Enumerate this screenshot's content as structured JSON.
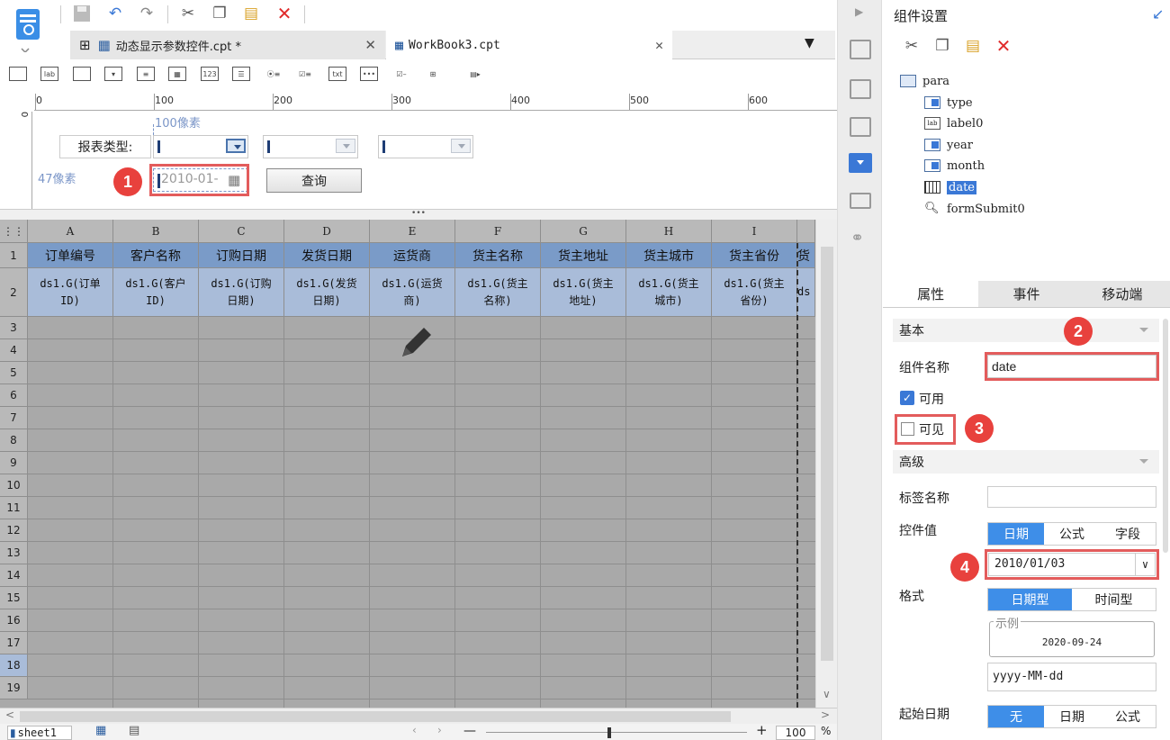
{
  "tabs": [
    {
      "label": "动态显示参数控件.cpt *"
    },
    {
      "label": "WorkBook3.cpt"
    }
  ],
  "ruler": {
    "marks": [
      "0",
      "100",
      "200",
      "300",
      "400",
      "500",
      "600"
    ]
  },
  "params": {
    "width_hint": "100像素",
    "height_hint": "47像素",
    "report_type_label": "报表类型:",
    "date_placeholder": "2010-01-",
    "query_button": "查询"
  },
  "grid": {
    "columns": [
      "A",
      "B",
      "C",
      "D",
      "E",
      "F",
      "G",
      "H",
      "I"
    ],
    "rows": [
      "1",
      "2",
      "3",
      "4",
      "5",
      "6",
      "7",
      "8",
      "9",
      "10",
      "11",
      "12",
      "13",
      "14",
      "15",
      "16",
      "17",
      "18",
      "19"
    ],
    "header_row": [
      "订单编号",
      "客户名称",
      "订购日期",
      "发货日期",
      "运货商",
      "货主名称",
      "货主地址",
      "货主城市",
      "货主省份"
    ],
    "field_row": [
      [
        "ds1.G(订单",
        "ID)"
      ],
      [
        "ds1.G(客户",
        "ID)"
      ],
      [
        "ds1.G(订购",
        "日期)"
      ],
      [
        "ds1.G(发货",
        "日期)"
      ],
      [
        "ds1.G(运货",
        "商)"
      ],
      [
        "ds1.G(货主",
        "名称)"
      ],
      [
        "ds1.G(货主",
        "地址)"
      ],
      [
        "ds1.G(货主",
        "城市)"
      ],
      [
        "ds1.G(货主",
        "省份)"
      ]
    ],
    "overflow_header": "货",
    "overflow_field": "ds"
  },
  "bottom": {
    "sheet_tab": "sheet1",
    "zoom": "100",
    "zoom_unit": "%"
  },
  "panel": {
    "title": "组件设置",
    "tree_root": "para",
    "tree_items": [
      "type",
      "label0",
      "year",
      "month",
      "date",
      "formSubmit0"
    ],
    "prop_tabs": [
      "属性",
      "事件",
      "移动端"
    ],
    "section_basic": "基本",
    "name_label": "组件名称",
    "name_value": "date",
    "enabled_label": "可用",
    "visible_label": "可见",
    "section_advanced": "高级",
    "tag_label": "标签名称",
    "value_label": "控件值",
    "value_options": [
      "日期",
      "公式",
      "字段"
    ],
    "value_date": "2010/01/03",
    "format_label": "格式",
    "format_options": [
      "日期型",
      "时间型"
    ],
    "example_title": "示例",
    "example_value": "2020-09-24",
    "format_string": "yyyy-MM-dd",
    "start_label": "起始日期",
    "start_options": [
      "无",
      "日期",
      "公式"
    ]
  },
  "badges": [
    "1",
    "2",
    "3",
    "4"
  ]
}
